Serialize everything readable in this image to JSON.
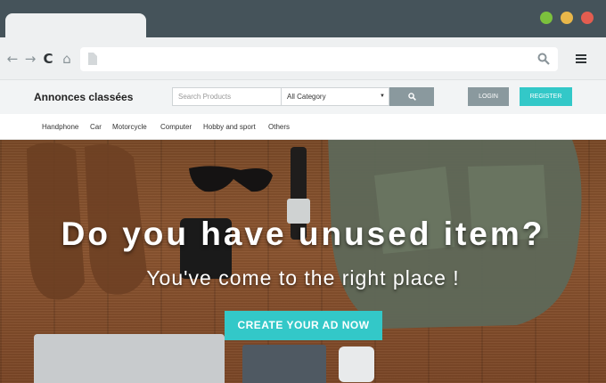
{
  "browser": {
    "nav_icons": {
      "back": "←",
      "forward": "→",
      "reload": "C",
      "home": "⌂"
    },
    "window_buttons": {
      "green": "#7cc13d",
      "yellow": "#e9b74a",
      "red": "#e35d50"
    }
  },
  "header": {
    "brand": "Annonces classées",
    "search_placeholder": "Search Products",
    "category_selected": "All Category",
    "login_label": "LOGIN",
    "register_label": "REGISTER"
  },
  "categories": [
    "Handphone",
    "Car",
    "Motorcycle",
    "Computer",
    "Hobby and sport",
    "Others"
  ],
  "hero": {
    "title": "Do you have unused item?",
    "subtitle": "You've come to the right place !",
    "cta_label": "CREATE YOUR AD NOW"
  },
  "colors": {
    "accent": "#33c8c8",
    "chrome": "#45535a",
    "button_grey": "#8a999e"
  }
}
